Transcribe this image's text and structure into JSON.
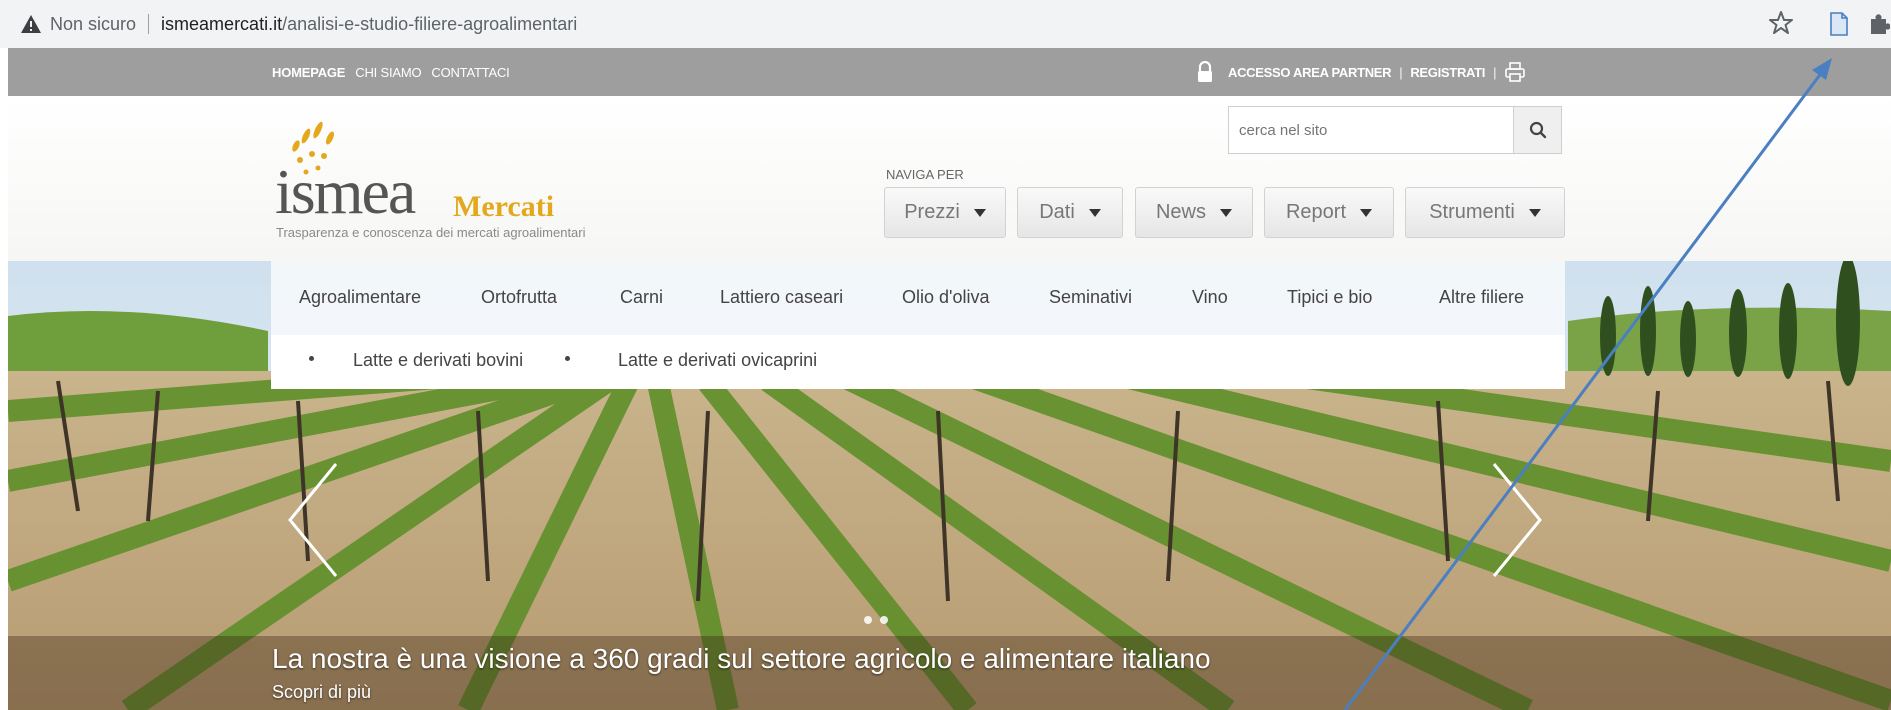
{
  "browser": {
    "security_label": "Non sicuro",
    "url_host": "ismeamercati.it",
    "url_path": "/analisi-e-studio-filiere-agroalimentari",
    "icons": [
      "warning-icon",
      "star-icon",
      "document-icon",
      "extensions-icon"
    ]
  },
  "topbar": {
    "homepage": "HOMEPAGE",
    "chi_siamo": "CHI SIAMO",
    "contattaci": "CONTATTACI",
    "accesso": "ACCESSO AREA PARTNER",
    "pipe": "|",
    "registrati": "REGISTRATI",
    "background": "#9e9e9e"
  },
  "logo": {
    "word": "ismea",
    "mercati": "Mercati",
    "tagline": "Trasparenza e conoscenza dei mercati agroalimentari",
    "accent": "#e3a81b"
  },
  "search": {
    "placeholder": "cerca nel sito"
  },
  "nav": {
    "naviga_per": "NAVIGA PER",
    "items": [
      {
        "label": "Prezzi"
      },
      {
        "label": "Dati"
      },
      {
        "label": "News"
      },
      {
        "label": "Report"
      },
      {
        "label": "Strumenti"
      }
    ]
  },
  "categories": {
    "items": [
      {
        "label": "Agroalimentare"
      },
      {
        "label": "Ortofrutta"
      },
      {
        "label": "Carni"
      },
      {
        "label": "Lattiero caseari"
      },
      {
        "label": "Olio d'oliva"
      },
      {
        "label": "Seminativi"
      },
      {
        "label": "Vino"
      },
      {
        "label": "Tipici e bio"
      },
      {
        "label": "Altre filiere"
      }
    ],
    "sub_items": [
      {
        "label": "Latte e derivati bovini"
      },
      {
        "label": "Latte e derivati ovicaprini"
      }
    ]
  },
  "hero": {
    "caption": "La nostra è una visione a 360 gradi sul settore agricolo e alimentare italiano",
    "more": "Scopri di più"
  },
  "annotation": {
    "color": "#4a7fc1"
  }
}
